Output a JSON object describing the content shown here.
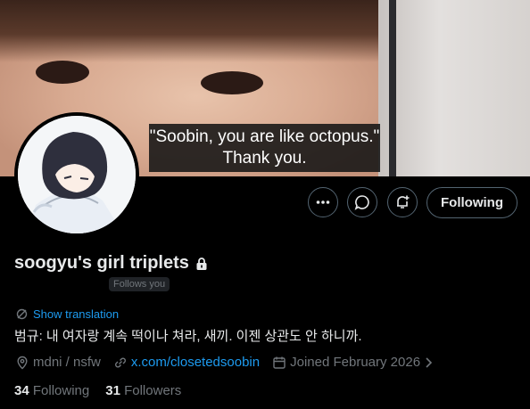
{
  "banner": {
    "caption_line1": "\"Soobin, you are like octopus.\"",
    "caption_line2": "Thank you."
  },
  "actions": {
    "more_icon": "more-icon",
    "message_icon": "message-icon",
    "notify_icon": "bell-plus-icon",
    "following_label": "Following"
  },
  "profile": {
    "display_name": "soogyu's girl triplets",
    "locked_icon": "lock-icon",
    "follows_you": "Follows you",
    "translate_label": "Show translation",
    "bio": "범규: 내 여자랑 계속 떡이나 쳐라, 새끼. 이젠 상관도 안 하니까.",
    "location": "mdni / nsfw",
    "link": "x.com/closetedsoobin",
    "joined": "Joined February 2026",
    "following_count": "34",
    "following_label": "Following",
    "followers_count": "31",
    "followers_label": "Followers"
  },
  "colors": {
    "accent": "#1d9bf0",
    "muted": "#71767b",
    "background": "#000000"
  }
}
